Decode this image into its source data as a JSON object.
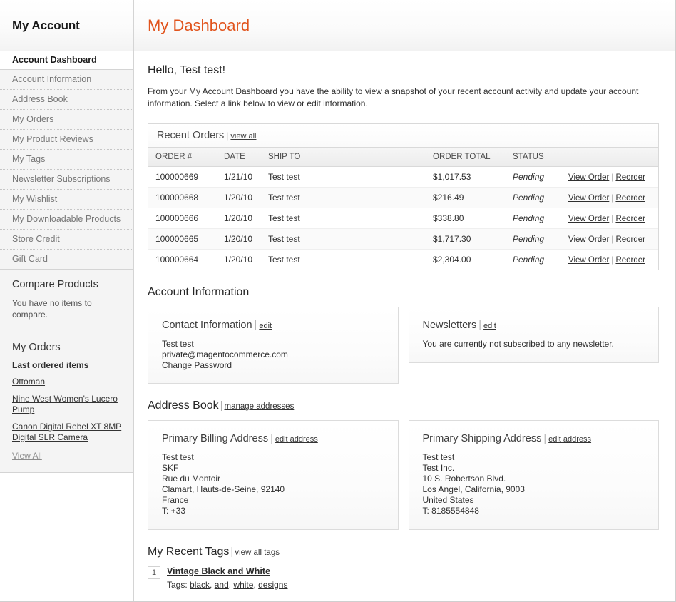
{
  "sidebar": {
    "title": "My Account",
    "nav": [
      {
        "label": "Account Dashboard",
        "active": true
      },
      {
        "label": "Account Information",
        "active": false
      },
      {
        "label": "Address Book",
        "active": false
      },
      {
        "label": "My Orders",
        "active": false
      },
      {
        "label": "My Product Reviews",
        "active": false
      },
      {
        "label": "My Tags",
        "active": false
      },
      {
        "label": "Newsletter Subscriptions",
        "active": false
      },
      {
        "label": "My Wishlist",
        "active": false
      },
      {
        "label": "My Downloadable Products",
        "active": false
      },
      {
        "label": "Store Credit",
        "active": false
      },
      {
        "label": "Gift Card",
        "active": false
      }
    ],
    "compare": {
      "title": "Compare Products",
      "empty_text": "You have no items to compare."
    },
    "orders_block": {
      "title": "My Orders",
      "subtitle": "Last ordered items",
      "items": [
        "Ottoman",
        "Nine West Women's Lucero Pump",
        "Canon Digital Rebel XT 8MP Digital SLR Camera"
      ],
      "view_all": "View All"
    }
  },
  "header": {
    "title": "My Dashboard",
    "accent_color": "#e1541d"
  },
  "greeting": "Hello, Test test!",
  "intro": "From your My Account Dashboard you have the ability to view a snapshot of your recent account activity and update your account information. Select a link below to view or edit information.",
  "recent_orders": {
    "title": "Recent Orders",
    "view_all": "view all",
    "columns": [
      "ORDER #",
      "DATE",
      "SHIP TO",
      "ORDER TOTAL",
      "STATUS"
    ],
    "action_view": "View Order",
    "action_reorder": "Reorder",
    "action_separator": "|",
    "rows": [
      {
        "order": "100000669",
        "date": "1/21/10",
        "ship_to": "Test test",
        "total": "$1,017.53",
        "status": "Pending"
      },
      {
        "order": "100000668",
        "date": "1/20/10",
        "ship_to": "Test test",
        "total": "$216.49",
        "status": "Pending"
      },
      {
        "order": "100000666",
        "date": "1/20/10",
        "ship_to": "Test test",
        "total": "$338.80",
        "status": "Pending"
      },
      {
        "order": "100000665",
        "date": "1/20/10",
        "ship_to": "Test test",
        "total": "$1,717.30",
        "status": "Pending"
      },
      {
        "order": "100000664",
        "date": "1/20/10",
        "ship_to": "Test test",
        "total": "$2,304.00",
        "status": "Pending"
      }
    ]
  },
  "account_information": {
    "section_title": "Account Information",
    "contact": {
      "title": "Contact Information",
      "edit": "edit",
      "name": "Test test",
      "email": "private@magentocommerce.com",
      "change_password": "Change Password"
    },
    "newsletters": {
      "title": "Newsletters",
      "edit": "edit",
      "text": "You are currently not subscribed to any newsletter."
    }
  },
  "address_book": {
    "section_title": "Address Book",
    "manage_link": "manage addresses",
    "billing": {
      "title": "Primary Billing Address",
      "edit": "edit address",
      "lines": [
        "Test test",
        "SKF",
        "Rue du Montoir",
        "Clamart, Hauts-de-Seine, 92140",
        "France",
        "T: +33"
      ]
    },
    "shipping": {
      "title": "Primary Shipping Address",
      "edit": "edit address",
      "lines": [
        "Test test",
        "Test Inc.",
        "10 S. Robertson Blvd.",
        "Los Angel, California, 9003",
        "United States",
        "T: 8185554848"
      ]
    }
  },
  "recent_tags": {
    "section_title": "My Recent Tags",
    "view_all": "view all tags",
    "entries": [
      {
        "number": "1",
        "product": "Vintage Black and White",
        "tags_label": "Tags:",
        "tags": [
          "black",
          "and",
          "white",
          "designs"
        ]
      }
    ]
  },
  "separators": {
    "pipe": "|",
    "comma": ", "
  }
}
